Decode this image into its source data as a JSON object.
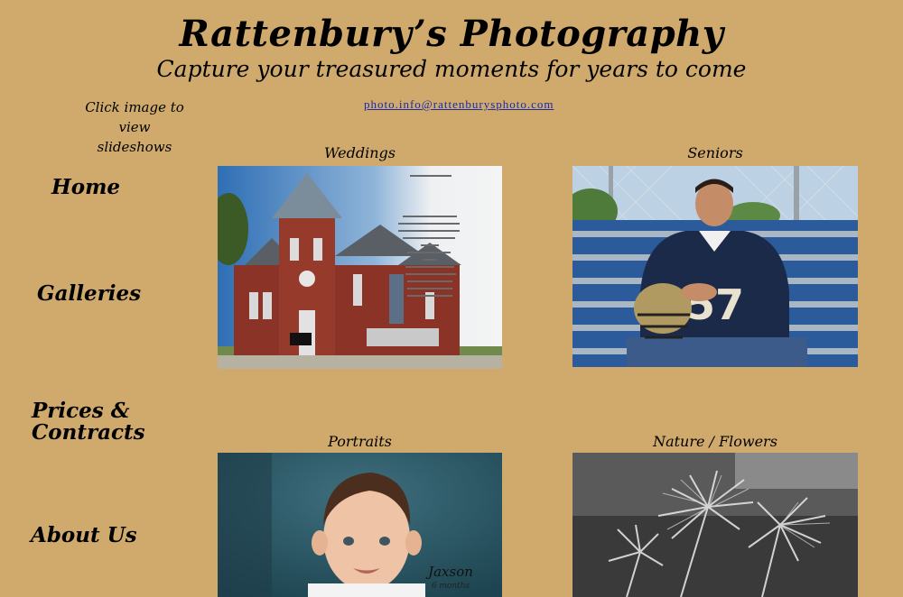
{
  "header": {
    "title": "Rattenbury’s Photography",
    "subtitle": "Capture your treasured moments for years to come",
    "email": "photo.info@rattenburysphoto.com"
  },
  "sidebar": {
    "hint_line1": "Click image to",
    "hint_line2": "view slideshows",
    "items": [
      {
        "label": "Home"
      },
      {
        "label": "Galleries"
      },
      {
        "label_line1": "Prices &",
        "label_line2": "Contracts"
      },
      {
        "label": "About Us"
      }
    ]
  },
  "galleries": [
    {
      "caption": "Weddings"
    },
    {
      "caption": "Seniors",
      "jersey_number": "57"
    },
    {
      "caption": "Portraits",
      "name_overlay": "Jaxson",
      "age_overlay": "6 months"
    },
    {
      "caption": "Nature / Flowers"
    }
  ]
}
